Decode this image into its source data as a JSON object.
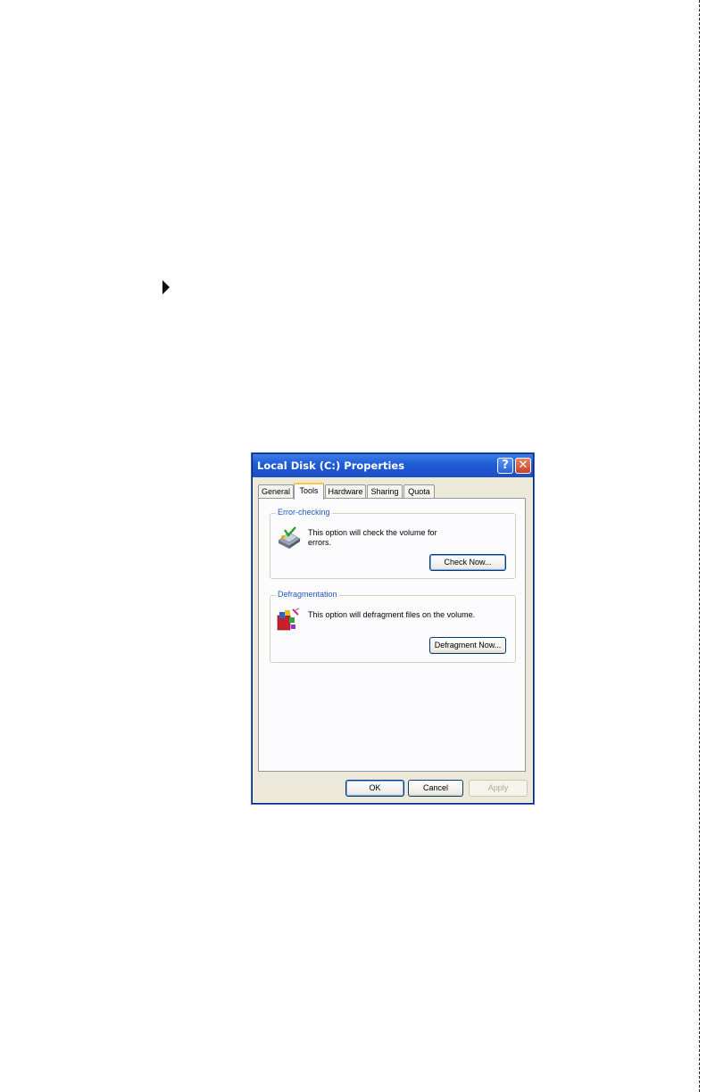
{
  "dialog": {
    "title": "Local Disk (C:) Properties",
    "help_glyph": "?",
    "close_glyph": "✕",
    "tabs": [
      {
        "label": "General"
      },
      {
        "label": "Tools",
        "active": true
      },
      {
        "label": "Hardware"
      },
      {
        "label": "Sharing"
      },
      {
        "label": "Quota"
      }
    ],
    "error_checking": {
      "heading": "Error-checking",
      "description": "This option will check the volume for errors.",
      "button_label": "Check Now...",
      "icon": "disk-check-icon"
    },
    "defragmentation": {
      "heading": "Defragmentation",
      "description": "This option will defragment files on the volume.",
      "button_label": "Defragment Now...",
      "icon": "defragment-icon"
    },
    "footer": {
      "ok_label": "OK",
      "cancel_label": "Cancel",
      "apply_label": "Apply",
      "apply_enabled": false
    }
  },
  "page": {
    "bullet_icon": "triangle-bullet-icon"
  },
  "colors": {
    "titlebar": "#1f5ad6",
    "group_heading": "#2457c5",
    "dialog_bg": "#ece9d8"
  }
}
